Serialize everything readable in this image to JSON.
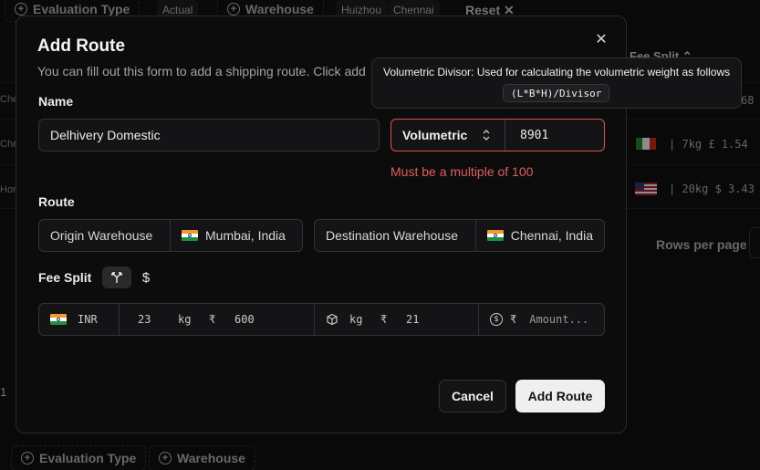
{
  "background": {
    "top_chips": [
      "Evaluation Type",
      "Warehouse"
    ],
    "top_tags": [
      "Actual",
      "Huizhou",
      "Chennai"
    ],
    "reset_label": "Reset",
    "fee_split_header": "Fee Split",
    "row_prefixes": [
      "Che",
      "Che",
      "Hor"
    ],
    "rows": [
      {
        "end": "68"
      },
      {
        "value": "7kg £ 1.54"
      },
      {
        "value": "20kg $ 3.43"
      }
    ],
    "rows_per_page": "Rows per page",
    "footer_left": "1",
    "bottom_chips": [
      "Evaluation Type",
      "Warehouse"
    ]
  },
  "modal": {
    "title": "Add Route",
    "description": "You can fill out this form to add a shipping route. Click add",
    "name_label": "Name",
    "name_value": "Delhivery Domestic",
    "volumetric_select": "Volumetric",
    "volumetric_value": "8901",
    "error": "Must be a multiple of 100",
    "route_label": "Route",
    "origin_label": "Origin Warehouse",
    "origin_value": "Mumbai, India",
    "destination_label": "Destination Warehouse",
    "destination_value": "Chennai, India",
    "fee_split_label": "Fee Split",
    "fee_row": {
      "currency": "INR",
      "weight_value": "23",
      "weight_unit": "kg",
      "currency_symbol": "₹",
      "amount": "600",
      "per_kg_unit": "kg",
      "per_kg_symbol": "₹",
      "per_kg_value": "21",
      "fixed_symbol": "₹",
      "fixed_placeholder": "Amount..."
    },
    "cancel_label": "Cancel",
    "submit_label": "Add Route"
  },
  "tooltip": {
    "text": "Volumetric Divisor: Used for calculating the volumetric weight as follows",
    "formula": "(L*B*H)/Divisor"
  },
  "colors": {
    "error": "#e05d5d",
    "primary_button": "#efefef"
  }
}
